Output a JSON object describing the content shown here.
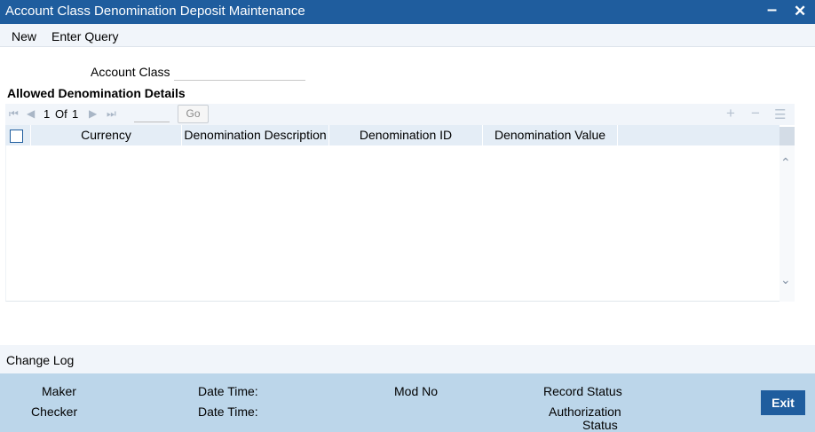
{
  "window": {
    "title": "Account Class Denomination Deposit Maintenance",
    "minimize_icon": "minimize-icon",
    "close_icon": "close-icon"
  },
  "menu": {
    "new_label": "New",
    "enter_query_label": "Enter Query"
  },
  "form": {
    "account_class_label": "Account Class",
    "account_class_value": ""
  },
  "section": {
    "title": "Allowed Denomination Details"
  },
  "pagination": {
    "current": "1",
    "of_label": "Of",
    "total": "1",
    "page_input_value": "",
    "go_label": "Go"
  },
  "grid": {
    "columns": [
      "Currency",
      "Denomination Description",
      "Denomination ID",
      "Denomination Value"
    ],
    "rows": []
  },
  "change_log": {
    "label": "Change Log"
  },
  "footer": {
    "maker_label": "Maker",
    "checker_label": "Checker",
    "date_time_label_1": "Date Time:",
    "date_time_label_2": "Date Time:",
    "mod_no_label": "Mod No",
    "record_status_label": "Record Status",
    "authorization_status_line1": "Authorization",
    "authorization_status_line2": "Status",
    "exit_label": "Exit"
  },
  "colors": {
    "title_bar": "#1f5d9e",
    "menu_bg": "#f1f5fa",
    "grid_header": "#e4edf6",
    "footer_bg": "#bcd6ea",
    "exit_button": "#1f5d9e"
  }
}
